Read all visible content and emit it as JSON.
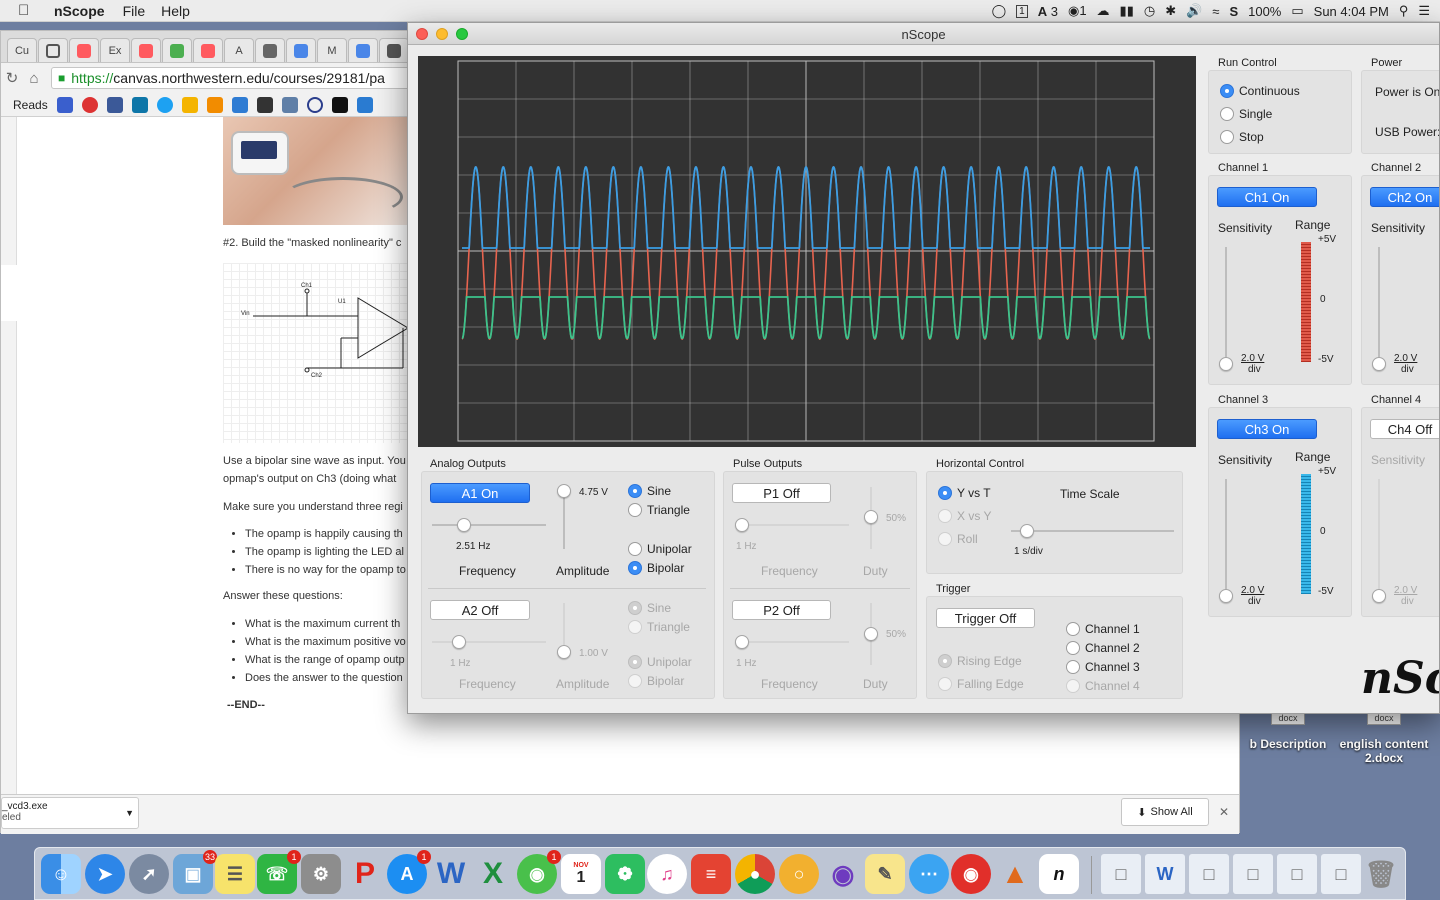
{
  "menubar": {
    "apple": "",
    "app_name": "nScope",
    "menus": [
      "File",
      "Help"
    ],
    "status": {
      "calendar_day": "1",
      "adobe_count": "3",
      "notifications_count": "1",
      "battery": "100%",
      "clock": "Sun 4:04 PM"
    }
  },
  "browser": {
    "tabs": [
      "Cu",
      "",
      "",
      "Ex",
      "",
      "",
      "",
      "A",
      "",
      "",
      "M",
      "",
      ""
    ],
    "url_scheme": "https://",
    "url_rest": "canvas.northwestern.edu/courses/29181/pa",
    "bookmarks_label": "Reads",
    "doc": {
      "step2": "#2. Build the \"masked nonlinearity\" c",
      "para1_line1": "Use a bipolar sine wave as input. You",
      "para1_line2": "opmap's output on Ch3 (doing what",
      "para2": "Make sure you understand three regi",
      "list1": [
        "The opamp is happily causing th",
        "The opamp is lighting the LED al",
        "There is no way for the opamp to"
      ],
      "answer": "Answer these questions:",
      "list2": [
        "What is the maximum current th",
        "What is the maximum positive vo",
        "What is the range of opamp outp",
        "Does the answer to the question"
      ],
      "end": "--END--",
      "circuit_labels": {
        "ch1": "Ch1",
        "u1": "U1",
        "vin": "Vin",
        "ch2": "Ch2"
      }
    },
    "download": {
      "name": "_vcd3.exe",
      "status": "eled"
    },
    "show_all": "Show All"
  },
  "desktop_files": [
    {
      "tag": "docx",
      "name": "b Description"
    },
    {
      "tag": "docx",
      "name": "english content",
      "name2": "2.docx"
    }
  ],
  "nscope": {
    "title": "nScope",
    "analog_outputs": {
      "title": "Analog Outputs",
      "a1": {
        "button": "A1 On",
        "frequency_value": "2.51 Hz",
        "amplitude_value": "4.75 V",
        "frequency_label": "Frequency",
        "amplitude_label": "Amplitude",
        "wave": [
          "Sine",
          "Triangle"
        ],
        "polarity": [
          "Unipolar",
          "Bipolar"
        ],
        "frequency_level": 0.28,
        "amplitude_level": 1.0
      },
      "a2": {
        "button": "A2 Off",
        "frequency_value": "1 Hz",
        "amplitude_value": "1.00 V",
        "frequency_label": "Frequency",
        "amplitude_label": "Amplitude",
        "wave": [
          "Sine",
          "Triangle"
        ],
        "polarity": [
          "Unipolar",
          "Bipolar"
        ]
      }
    },
    "pulse_outputs": {
      "title": "Pulse Outputs",
      "p1": {
        "button": "P1 Off",
        "frequency_value": "1 Hz",
        "duty_value": "50%",
        "frequency_label": "Frequency",
        "duty_label": "Duty"
      },
      "p2": {
        "button": "P2 Off",
        "frequency_value": "1 Hz",
        "duty_value": "50%",
        "frequency_label": "Frequency",
        "duty_label": "Duty"
      }
    },
    "horizontal_control": {
      "title": "Horizontal Control",
      "modes": [
        "Y vs T",
        "X vs Y",
        "Roll"
      ],
      "time_scale_label": "Time Scale",
      "time_scale_value": "1 s/div"
    },
    "trigger": {
      "title": "Trigger",
      "button": "Trigger Off",
      "edges": [
        "Rising Edge",
        "Falling Edge"
      ],
      "channels": [
        "Channel 1",
        "Channel 2",
        "Channel 3",
        "Channel 4"
      ]
    },
    "run_control": {
      "title": "Run Control",
      "options": [
        "Continuous",
        "Single",
        "Stop"
      ]
    },
    "power": {
      "title": "Power",
      "status": "Power is On",
      "usb": "USB Power:"
    },
    "channel1": {
      "title": "Channel 1",
      "button": "Ch1 On",
      "sensitivity_label": "Sensitivity",
      "range_label": "Range",
      "sens_value": "2.0 V",
      "sens_unit": "div",
      "range_top": "+5V",
      "range_mid": "0",
      "range_bot": "-5V"
    },
    "channel2": {
      "title": "Channel 2",
      "button": "Ch2 On",
      "sensitivity_label": "Sensitivity",
      "sens_value": "2.0 V",
      "sens_unit": "div"
    },
    "channel3": {
      "title": "Channel 3",
      "button": "Ch3 On",
      "sensitivity_label": "Sensitivity",
      "range_label": "Range",
      "sens_value": "2.0 V",
      "sens_unit": "div",
      "range_top": "+5V",
      "range_mid": "0",
      "range_bot": "-5V"
    },
    "channel4": {
      "title": "Channel 4",
      "button": "Ch4 Off",
      "sensitivity_label": "Sensitivity",
      "sens_value": "2.0 V",
      "sens_unit": "div"
    },
    "logo": "nSc",
    "colors": {
      "ch1": "#e8644f",
      "ch2": "#3a9ee4",
      "ch3": "#3cc38c",
      "grid": "#bdbdbd",
      "screen": "#323232",
      "accent": "#1f6ff0"
    }
  },
  "dock": {
    "apps": [
      "Finder",
      "Safari",
      "Launchpad",
      "Preview",
      "Stickies",
      "FaceTime",
      "System Preferences",
      "P",
      "App Store",
      "Word",
      "Excel",
      "WeChat",
      "Calendar",
      "Evernote",
      "iTunes",
      "Todoist",
      "Chrome",
      "Sync",
      "GitHub",
      "Notes",
      "Messages",
      "NetEase Music",
      "MATLAB",
      "nScope",
      "Trash"
    ],
    "badges": {
      "preview": "33",
      "facetime": "1",
      "appstore": "1",
      "wechat": "1"
    },
    "calendar_month": "NOV",
    "calendar_day": "1"
  }
}
